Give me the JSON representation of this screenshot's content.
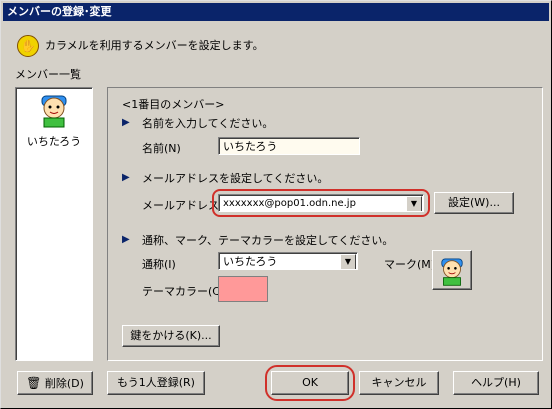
{
  "window": {
    "title": "メンバーの登録･変更"
  },
  "hint": {
    "text": "カラメルを利用するメンバーを設定します。"
  },
  "member_list": {
    "label": "メンバー一覧",
    "items": [
      {
        "name": "いちたろう",
        "icon": "boy-with-cap-icon"
      }
    ]
  },
  "panel": {
    "heading": "<1番目のメンバー>",
    "name_section": {
      "instruction": "名前を入力してください。",
      "label": "名前(N)",
      "value": "いちたろう"
    },
    "mail_section": {
      "instruction": "メールアドレスを設定してください。",
      "label": "メールアドレス(A)",
      "value": "xxxxxxx@pop01.odn.ne.jp",
      "settings_button": "設定(W)..."
    },
    "style_section": {
      "instruction": "通称、マーク、テーマカラーを設定してください。",
      "nickname_label": "通称(I)",
      "nickname_value": "いちたろう",
      "mark_label": "マーク(M)",
      "mark_icon": "boy-with-cap-icon",
      "theme_label": "テーマカラー(C)",
      "theme_color": "#ff9999"
    },
    "lock_button": "鍵をかける(K)..."
  },
  "buttons": {
    "delete": "削除(D)",
    "register_another": "もう1人登録(R)",
    "ok": "OK",
    "cancel": "キャンセル",
    "help": "ヘルプ(H)"
  },
  "colors": {
    "title_bar": "#0a246a",
    "highlight_ring": "#d0302a",
    "face": "#d4d0c8"
  }
}
